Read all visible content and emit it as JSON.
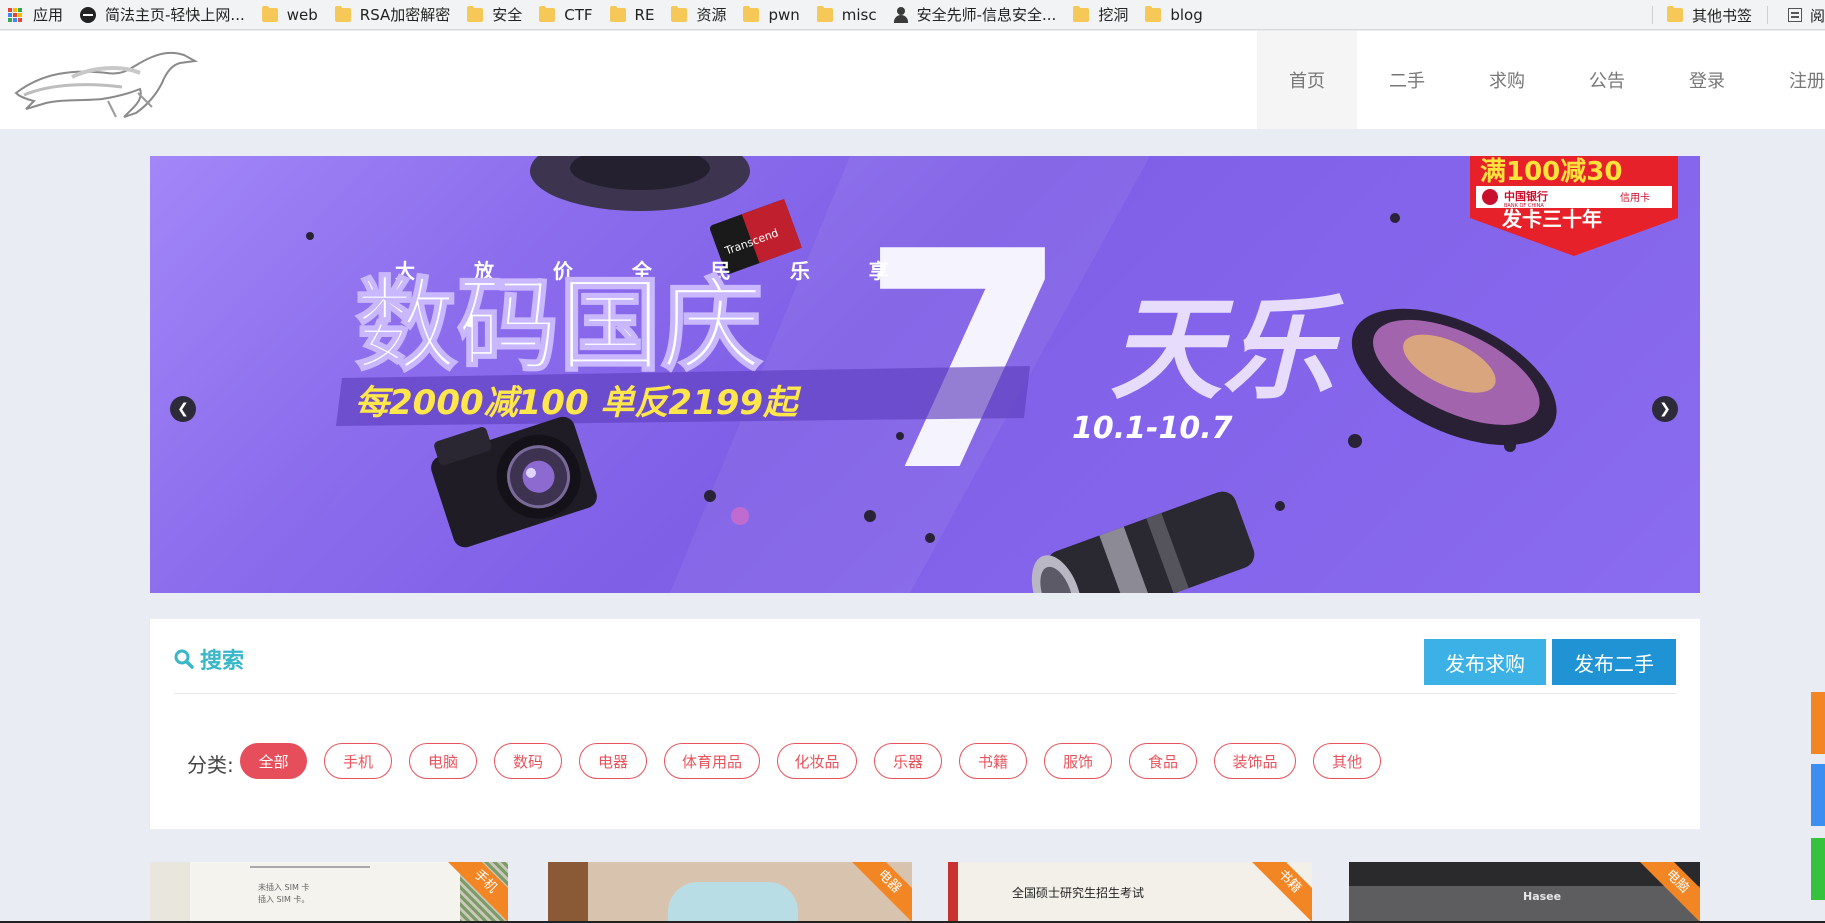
{
  "bookmarks": {
    "items": [
      {
        "label": "应用",
        "icon": "apps-grid-icon"
      },
      {
        "label": "简法主页-轻快上网...",
        "icon": "site-icon"
      },
      {
        "label": "web",
        "icon": "folder-icon"
      },
      {
        "label": "RSA加密解密",
        "icon": "folder-icon"
      },
      {
        "label": "安全",
        "icon": "folder-icon"
      },
      {
        "label": "CTF",
        "icon": "folder-icon"
      },
      {
        "label": "RE",
        "icon": "folder-icon"
      },
      {
        "label": "资源",
        "icon": "folder-icon"
      },
      {
        "label": "pwn",
        "icon": "folder-icon"
      },
      {
        "label": "misc",
        "icon": "folder-icon"
      },
      {
        "label": "安全先师-信息安全...",
        "icon": "person-icon"
      },
      {
        "label": "挖洞",
        "icon": "folder-icon"
      },
      {
        "label": "blog",
        "icon": "folder-icon"
      }
    ],
    "other": "其他书签",
    "reading": "阅"
  },
  "nav": {
    "items": [
      "首页",
      "二手",
      "求购",
      "公告",
      "登录",
      "注册"
    ],
    "active_index": 0
  },
  "banner": {
    "slogan_top": "大 放 价 全 民 乐 享",
    "headline": "数码国庆",
    "big_number": "7",
    "headline_tail": "天乐",
    "promo": "每2000减100  单反2199起",
    "dates": "10.1-10.7",
    "badge_top": "满100减30",
    "badge_bank": "中国银行",
    "badge_bank_en": "BANK OF CHINA",
    "badge_card": "信用卡",
    "badge_bottom": "发卡三十年",
    "sd_brand": "Transcend"
  },
  "search": {
    "title": "搜索",
    "btn_want": "发布求购",
    "btn_sell": "发布二手",
    "category_label": "分类:",
    "categories": [
      "全部",
      "手机",
      "电脑",
      "数码",
      "电器",
      "体育用品",
      "化妆品",
      "乐器",
      "书籍",
      "服饰",
      "食品",
      "装饰品",
      "其他"
    ],
    "active_category": 0
  },
  "products": [
    {
      "tag": "手机",
      "screen_text": [
        "未插入 SIM 卡",
        "插入 SIM 卡。"
      ]
    },
    {
      "tag": "电器"
    },
    {
      "tag": "书籍",
      "text": "全国硕士研究生招生考试"
    },
    {
      "tag": "电脑",
      "brand": "Hasee"
    }
  ],
  "colors": {
    "accent_teal": "#39b6c8",
    "btn_want": "#3cb1e5",
    "btn_sell": "#1f93d3",
    "category_red": "#e64e5c",
    "ribbon_orange": "#f28524",
    "page_bg": "#e9ecf3"
  }
}
